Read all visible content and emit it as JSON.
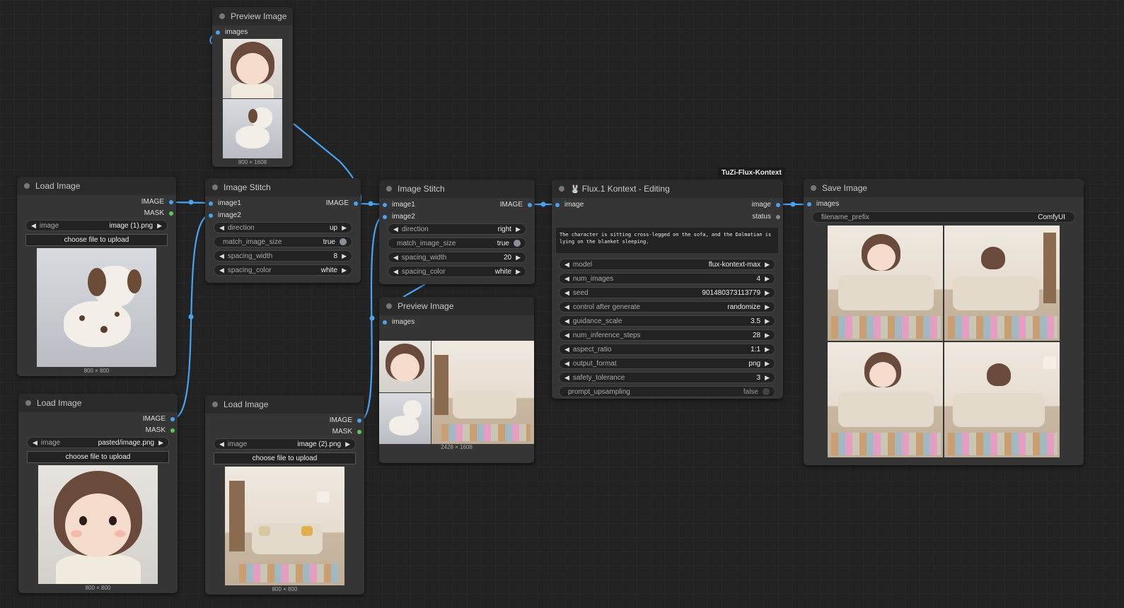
{
  "colors": {
    "wire": "#4aa3f0",
    "mask_slot": "#5cc95c",
    "node_bg": "#353535",
    "title_bg": "#2b2b2b"
  },
  "load_image_1": {
    "title": "Load Image",
    "out_image": "IMAGE",
    "out_mask": "MASK",
    "widget_label": "image",
    "widget_value": "image (1).png",
    "upload_label": "choose file to upload",
    "size": "800 × 800"
  },
  "load_image_2": {
    "title": "Load Image",
    "out_image": "IMAGE",
    "out_mask": "MASK",
    "widget_label": "image",
    "widget_value": "pasted/image.png",
    "upload_label": "choose file to upload",
    "size": "800 × 800"
  },
  "load_image_3": {
    "title": "Load Image",
    "out_image": "IMAGE",
    "out_mask": "MASK",
    "widget_label": "image",
    "widget_value": "image (2).png",
    "upload_label": "choose file to upload",
    "size": "800 × 800"
  },
  "preview_1": {
    "title": "Preview Image",
    "in_images": "images",
    "size": "800 × 1608"
  },
  "preview_2": {
    "title": "Preview Image",
    "in_images": "images",
    "size": "2428 × 1608"
  },
  "stitch_1": {
    "title": "Image Stitch",
    "in1": "image1",
    "in2": "image2",
    "out": "IMAGE",
    "widgets": [
      {
        "label": "direction",
        "value": "up"
      },
      {
        "label": "match_image_size",
        "value": "true"
      },
      {
        "label": "spacing_width",
        "value": "8"
      },
      {
        "label": "spacing_color",
        "value": "white"
      }
    ]
  },
  "stitch_2": {
    "title": "Image Stitch",
    "in1": "image1",
    "in2": "image2",
    "out": "IMAGE",
    "widgets": [
      {
        "label": "direction",
        "value": "right"
      },
      {
        "label": "match_image_size",
        "value": "true"
      },
      {
        "label": "spacing_width",
        "value": "20"
      },
      {
        "label": "spacing_color",
        "value": "white"
      }
    ]
  },
  "flux": {
    "badge": "TuZi-Flux-Kontext",
    "title": "Flux.1 Kontext - Editing",
    "in_image": "image",
    "out_image": "image",
    "out_status": "status",
    "prompt": "The character is sitting cross-legged on the sofa, and the Dalmatian is lying on the blanket sleeping.",
    "widgets": [
      {
        "label": "model",
        "value": "flux-kontext-max"
      },
      {
        "label": "num_images",
        "value": "4"
      },
      {
        "label": "seed",
        "value": "901480373113779"
      },
      {
        "label": "control after generate",
        "value": "randomize"
      },
      {
        "label": "guidance_scale",
        "value": "3.5"
      },
      {
        "label": "num_inference_steps",
        "value": "28"
      },
      {
        "label": "aspect_ratio",
        "value": "1:1"
      },
      {
        "label": "output_format",
        "value": "png"
      },
      {
        "label": "safety_tolerance",
        "value": "3"
      },
      {
        "label": "prompt_upsampling",
        "value": "false"
      }
    ]
  },
  "save": {
    "title": "Save Image",
    "in_images": "images",
    "filename_label": "filename_prefix",
    "filename_value": "ComfyUI"
  }
}
